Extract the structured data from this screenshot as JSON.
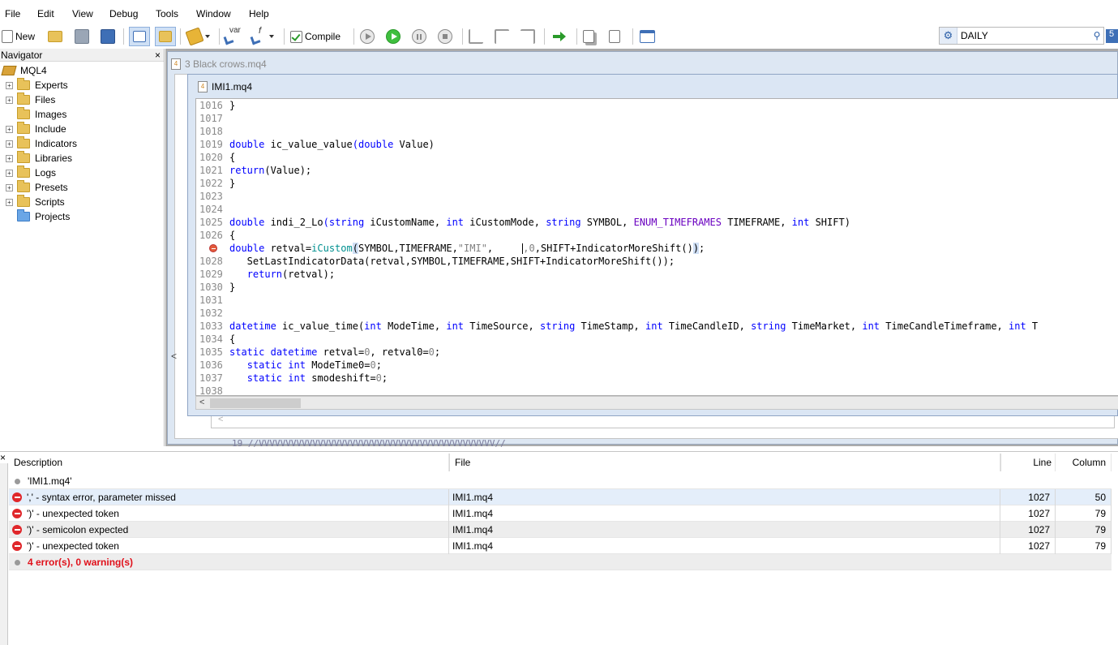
{
  "menu": [
    "File",
    "Edit",
    "View",
    "Debug",
    "Tools",
    "Window",
    "Help"
  ],
  "toolbar": {
    "new_label": "New",
    "var_label": "var",
    "f_label": "f",
    "compile_label": "Compile",
    "search_value": "DAILY",
    "right_edge_badge": "5"
  },
  "navigator": {
    "title": "Navigator",
    "close": "×",
    "root": "MQL4",
    "items": [
      "Experts",
      "Files",
      "Images",
      "Include",
      "Indicators",
      "Libraries",
      "Logs",
      "Presets",
      "Scripts",
      "Projects"
    ]
  },
  "editor": {
    "background_tab_title": "3 Black crows.mq4",
    "background_line": "19  //VVVVVVVVVVVVVVVVVVVVVVVVVVVVVVVVVVVVVVVVVVVV//",
    "window_title": "IMI1.mq4",
    "lines": [
      {
        "n": "1016",
        "html": "}"
      },
      {
        "n": "1017",
        "html": ""
      },
      {
        "n": "1018",
        "html": ""
      },
      {
        "n": "1019",
        "html": "<span class='kw'>double</span> ic_value_value<span class='kw'>(</span><span class='kw'>double</span> Value)"
      },
      {
        "n": "1020",
        "html": "{"
      },
      {
        "n": "1021",
        "html": "<span class='kw'>return</span>(Value);"
      },
      {
        "n": "1022",
        "html": "}"
      },
      {
        "n": "1023",
        "html": ""
      },
      {
        "n": "1024",
        "html": ""
      },
      {
        "n": "1025",
        "html": "<span class='kw'>double</span> indi_2_Lo<span class='kw'>(</span><span class='kw'>string</span> iCustomName, <span class='kw'>int</span> iCustomMode, <span class='kw'>string</span> SYMBOL, <span class='en'>ENUM_TIMEFRAMES</span> TIMEFRAME, <span class='kw'>int</span> SHIFT)"
      },
      {
        "n": "1026",
        "html": "{"
      },
      {
        "n": "",
        "html": "<span class='kw'>double</span> retval=<span class='fn'>iCustom</span><span class='hl'>(</span>SYMBOL,TIMEFRAME,<span class='str'>\"IMI\"</span>,     <span id='cursor-bar'></span><span class='num'>,0</span>,SHIFT+IndicatorMoreShift()<span class='hl'>)</span>;",
        "error": true
      },
      {
        "n": "1028",
        "html": "   SetLastIndicatorData(retval,SYMBOL,TIMEFRAME,SHIFT+IndicatorMoreShift());"
      },
      {
        "n": "1029",
        "html": "   <span class='kw'>return</span>(retval);"
      },
      {
        "n": "1030",
        "html": "}"
      },
      {
        "n": "1031",
        "html": ""
      },
      {
        "n": "1032",
        "html": ""
      },
      {
        "n": "1033",
        "html": "<span class='kw'>datetime</span> ic_value_time(<span class='kw'>int</span> ModeTime, <span class='kw'>int</span> TimeSource, <span class='kw'>string</span> TimeStamp, <span class='kw'>int</span> TimeCandleID, <span class='kw'>string</span> TimeMarket, <span class='kw'>int</span> TimeCandleTimeframe, <span class='kw'>int</span> T"
      },
      {
        "n": "1034",
        "html": "{"
      },
      {
        "n": "1035",
        "html": "<span class='kw'>static</span> <span class='kw'>datetime</span> retval=<span class='num'>0</span>, retval0=<span class='num'>0</span>;"
      },
      {
        "n": "1036",
        "html": "   <span class='kw'>static</span> <span class='kw'>int</span> ModeTime0=<span class='num'>0</span>;"
      },
      {
        "n": "1037",
        "html": "   <span class='kw'>static</span> <span class='kw'>int</span> smodeshift=<span class='num'>0</span>;"
      },
      {
        "n": "1038",
        "html": ""
      }
    ]
  },
  "errors": {
    "columns": {
      "description": "Description",
      "file": "File",
      "line": "Line",
      "column": "Column"
    },
    "header_row": "'IMI1.mq4'",
    "rows": [
      {
        "description": "',' - syntax error, parameter missed",
        "file": "IMI1.mq4",
        "line": "1027",
        "column": "50"
      },
      {
        "description": "')' - unexpected token",
        "file": "IMI1.mq4",
        "line": "1027",
        "column": "79"
      },
      {
        "description": "')' - semicolon expected",
        "file": "IMI1.mq4",
        "line": "1027",
        "column": "79"
      },
      {
        "description": "')' - unexpected token",
        "file": "IMI1.mq4",
        "line": "1027",
        "column": "79"
      }
    ],
    "summary": "4 error(s), 0 warning(s)",
    "panel_close": "×"
  }
}
